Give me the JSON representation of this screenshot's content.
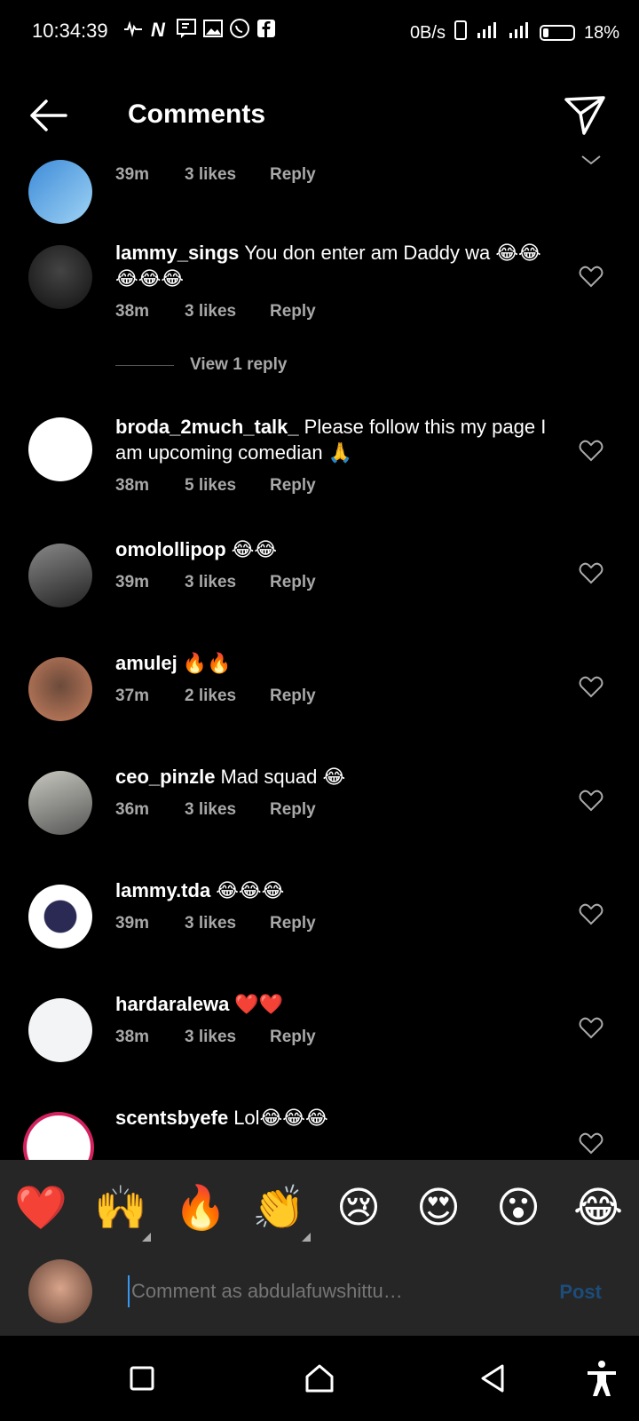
{
  "status_bar": {
    "time": "10:34:39",
    "network_speed": "0B/s",
    "battery_percent": "18%",
    "battery_level": 0.18
  },
  "header": {
    "title": "Comments"
  },
  "comments": [
    {
      "username": "",
      "text": "",
      "time": "39m",
      "likes": "3 likes",
      "reply": "Reply"
    },
    {
      "username": "lammy_sings",
      "text": "You don enter am Daddy wa 😂😂😂😂😂",
      "time": "38m",
      "likes": "3 likes",
      "reply": "Reply"
    },
    {
      "username": "broda_2much_talk_",
      "text": "Please follow this my page I am upcoming comedian 🙏",
      "time": "38m",
      "likes": "5 likes",
      "reply": "Reply"
    },
    {
      "username": "omolollipop",
      "text": "😂😂",
      "time": "39m",
      "likes": "3 likes",
      "reply": "Reply"
    },
    {
      "username": "amulej",
      "text": "🔥🔥",
      "time": "37m",
      "likes": "2 likes",
      "reply": "Reply"
    },
    {
      "username": "ceo_pinzle",
      "text": "Mad squad 😂",
      "time": "36m",
      "likes": "3 likes",
      "reply": "Reply"
    },
    {
      "username": "lammy.tda",
      "text": "😂😂😂",
      "time": "39m",
      "likes": "3 likes",
      "reply": "Reply"
    },
    {
      "username": "hardaralewa",
      "text": "❤️❤️",
      "time": "38m",
      "likes": "3 likes",
      "reply": "Reply"
    },
    {
      "username": "scentsbyefe",
      "text": "Lol😂😂😂",
      "time": "",
      "likes": "",
      "reply": ""
    }
  ],
  "view_replies": "View 1 reply",
  "reactions": [
    "❤️",
    "🙌",
    "🔥",
    "👏",
    "😢",
    "😍",
    "😮",
    "😂"
  ],
  "composer": {
    "placeholder": "Comment as abdulafuwshittu…",
    "post_label": "Post"
  },
  "colors": {
    "background": "#000000",
    "panel": "#262626",
    "secondary_text": "#a8a8a8",
    "post_disabled": "#1c4c7a"
  }
}
